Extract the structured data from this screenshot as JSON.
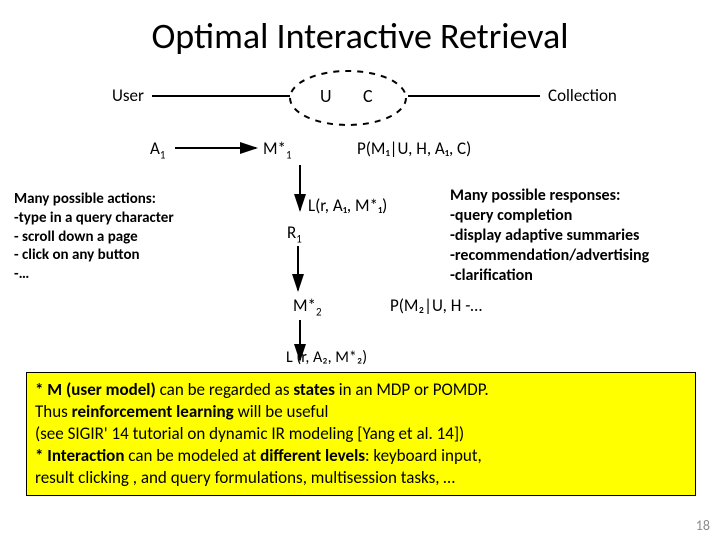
{
  "title": "Optimal Interactive Retrieval",
  "user_label": "User",
  "collection_label": "Collection",
  "node_U": "U",
  "node_C": "C",
  "A1_label": "A",
  "M1_label": "M*",
  "P1_label": "P(M₁|U, H, A₁, C)",
  "L1_label": "L(r, A₁, M*₁)",
  "R1_label": "R",
  "M2_label": "M*",
  "P2_label": "P(M₂|U, H",
  "P2_tail": " -…",
  "L2_label": "L (r, A₂, M*₂)",
  "actions": {
    "heading": "Many possible actions:",
    "items": [
      "-type in a query character",
      "- scroll down a page",
      "- click on any button",
      "-…"
    ]
  },
  "responses": {
    "heading": "Many possible responses:",
    "items": [
      "-query completion",
      "-display adaptive summaries",
      "-recommendation/advertising",
      "-clarification"
    ]
  },
  "note": {
    "line1a": "* M (user model) ",
    "line1b": "can be regarded as ",
    "line1c": "states",
    "line1d": " in  an MDP or POMDP.",
    "line2a": "   Thus ",
    "line2b": "reinforcement learning ",
    "line2c": "will be useful",
    "line3": "   (see SIGIR' 14 tutorial on dynamic IR modeling [Yang et al. 14])",
    "line4a": "* Interaction ",
    "line4b": "can be modeled at ",
    "line4c": "different levels",
    "line4d": ": keyboard input,",
    "line5": "result clicking , and query formulations, multisession tasks, …"
  },
  "slide_number": "18"
}
